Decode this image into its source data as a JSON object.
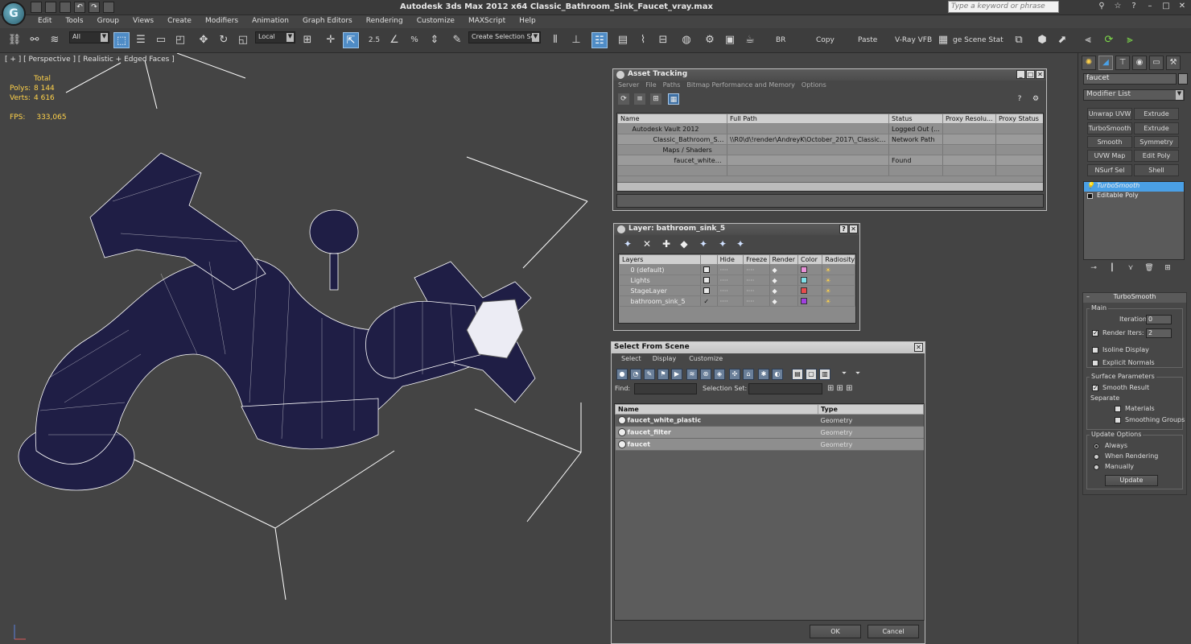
{
  "window": {
    "title": "Autodesk 3ds Max  2012 x64     Classic_Bathroom_Sink_Faucet_vray.max",
    "search_placeholder": "Type a keyword or phrase",
    "logo": "3ds-max-logo"
  },
  "menu": [
    "Edit",
    "Tools",
    "Group",
    "Views",
    "Create",
    "Modifiers",
    "Animation",
    "Graph Editors",
    "Rendering",
    "Customize",
    "MAXScript",
    "Help"
  ],
  "toolbar": {
    "selection_filter": "All",
    "ref_coord": "Local",
    "snap_value": "2.5",
    "selection_set": "Create Selection Se",
    "br_label": "BR",
    "copy_label": "Copy",
    "paste_label": "Paste",
    "vray_vfb_label": "V-Ray VFB",
    "image_scene_label": "ge Scene Stat"
  },
  "viewport": {
    "label": "[ + ] [ Perspective ] [ Realistic + Edged Faces ]",
    "stats_header": "Total",
    "polys_label": "Polys:",
    "polys_value": "8 144",
    "verts_label": "Verts:",
    "verts_value": "4 616",
    "fps_label": "FPS:",
    "fps_value": "333,065"
  },
  "asset_tracking": {
    "title": "Asset Tracking",
    "menu": [
      "Server",
      "File",
      "Paths",
      "Bitmap Performance and Memory",
      "Options"
    ],
    "columns": [
      "Name",
      "Full Path",
      "Status",
      "Proxy Resolu...",
      "Proxy Status"
    ],
    "rows": [
      {
        "name": "Autodesk Vault 2012",
        "path": "",
        "status": "Logged Out (...",
        "res": "",
        "pstatus": ""
      },
      {
        "name": "Classic_Bathroom_Sin...",
        "path": "\\\\R0\\d\\!render\\AndreyK\\October_2017\\_Classic_...",
        "status": "Network Path",
        "res": "",
        "pstatus": ""
      },
      {
        "name": "Maps / Shaders",
        "path": "",
        "status": "",
        "res": "",
        "pstatus": ""
      },
      {
        "name": "faucet_white_...",
        "path": "",
        "status": "Found",
        "res": "",
        "pstatus": ""
      }
    ]
  },
  "layer": {
    "title": "Layer: bathroom_sink_5",
    "columns": [
      "Layers",
      "Hide",
      "Freeze",
      "Render",
      "Color",
      "Radiosity"
    ],
    "rows": [
      {
        "name": "0 (default)",
        "color": "#e890d8"
      },
      {
        "name": "Lights",
        "color": "#7fe0e8"
      },
      {
        "name": "StageLayer",
        "color": "#e84c4c"
      },
      {
        "name": "bathroom_sink_5",
        "color": "#a040e0"
      }
    ]
  },
  "select_from_scene": {
    "title": "Select From Scene",
    "menu": [
      "Select",
      "Display",
      "Customize"
    ],
    "find_label": "Find:",
    "selection_set_label": "Selection Set:",
    "col_name": "Name",
    "col_type": "Type",
    "rows": [
      {
        "name": "faucet_white_plastic",
        "type": "Geometry"
      },
      {
        "name": "faucet_filter",
        "type": "Geometry"
      },
      {
        "name": "faucet",
        "type": "Geometry"
      }
    ],
    "ok_label": "OK",
    "cancel_label": "Cancel"
  },
  "command_panel": {
    "object_name": "faucet",
    "modifier_list": "Modifier List",
    "mod_buttons": [
      "Unwrap UVW",
      "Extrude",
      "TurboSmooth",
      "Extrude",
      "Smooth",
      "Symmetry",
      "UVW Map",
      "Edit Poly",
      "NSurf Sel",
      "Shell"
    ],
    "stack": [
      "TurboSmooth",
      "Editable Poly"
    ],
    "rollout_title": "TurboSmooth",
    "main_label": "Main",
    "iterations_label": "Iterations:",
    "iterations_value": "0",
    "render_iters_label": "Render Iters:",
    "render_iters_value": "2",
    "isoline_label": "Isoline Display",
    "explicit_label": "Explicit Normals",
    "surface_label": "Surface Parameters",
    "smooth_result_label": "Smooth Result",
    "separate_label": "Separate",
    "materials_label": "Materials",
    "smoothing_groups_label": "Smoothing Groups",
    "update_options_label": "Update Options",
    "always_label": "Always",
    "when_rendering_label": "When Rendering",
    "manually_label": "Manually",
    "update_button": "Update"
  }
}
